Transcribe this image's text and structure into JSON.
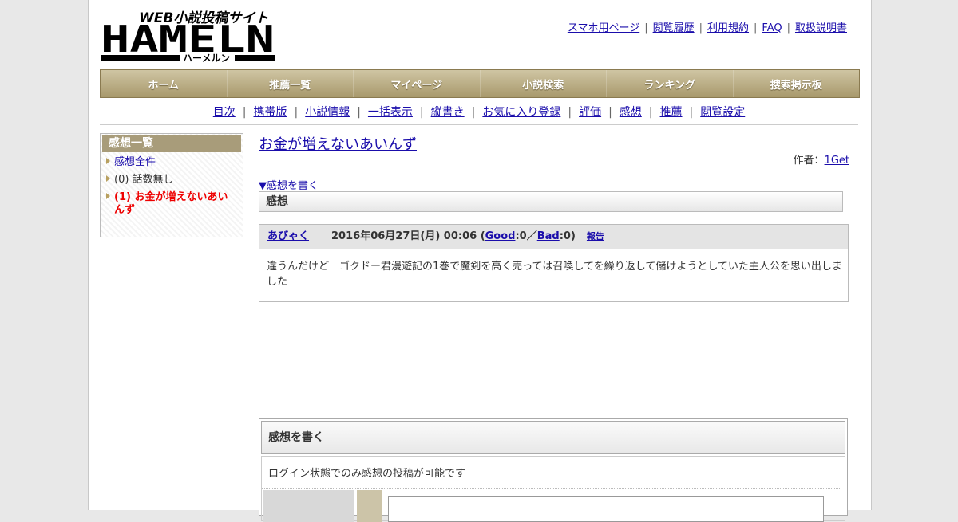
{
  "header": {
    "logo": {
      "tagline": "WEB小説投稿サイト",
      "name": "HAMELN",
      "kana": "ハーメルン"
    },
    "top_links": [
      "スマホ用ページ",
      "閲覧履歴",
      "利用規約",
      "FAQ",
      "取扱説明書"
    ]
  },
  "nav": [
    "ホーム",
    "推薦一覧",
    "マイページ",
    "小説検索",
    "ランキング",
    "捜索掲示板"
  ],
  "subnav": [
    "目次",
    "携帯版",
    "小説情報",
    "一括表示",
    "縦書き",
    "お気に入り登録",
    "評価",
    "感想",
    "推薦",
    "閲覧設定"
  ],
  "sidebar": {
    "title": "感想一覧",
    "items": [
      "感想全件",
      "(0) 話数無し",
      "(1) お金が増えないあいんず"
    ]
  },
  "main": {
    "novel_title": "お金が増えないあいんず",
    "author_label": "作者：",
    "author_name": "1Get",
    "write_link": "▼感想を書く",
    "section_title": "感想"
  },
  "review": {
    "user": "あびゃく",
    "date": "2016年06月27日(月) 00:06 (",
    "good_label": "Good",
    "good_count": ":0／",
    "bad_label": "Bad",
    "bad_count": ":0)",
    "report": "報告",
    "text": "違うんだけど　ゴクドー君漫遊記の1巻で魔剣を高く売っては召喚してを繰り返して儲けようとしていた主人公を思い出しました"
  },
  "form": {
    "title": "感想を書く",
    "note": "ログイン状態でのみ感想の投稿が可能です"
  },
  "colors": {
    "nav_bg": "#b5a67a",
    "sidebar_head": "#a89c7a",
    "link": "#1a0dab",
    "active": "#ee0000"
  }
}
